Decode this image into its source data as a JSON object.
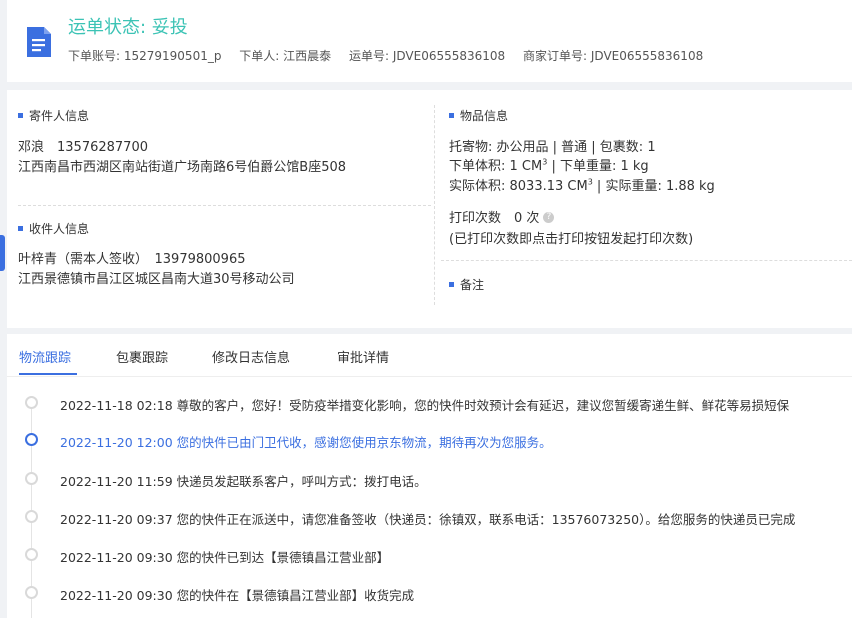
{
  "header": {
    "status_title": "运单状态: 妥投",
    "order_account": "下单账号: 15279190501_p",
    "orderer": "下单人: 江西晨泰",
    "waybill": "运单号: JDVE06555836108",
    "merchant_order": "商家订单号: JDVE06555836108",
    "icon": "document-icon"
  },
  "sender": {
    "title": "寄件人信息",
    "name_phone": "邓浪　13576287700",
    "address": "江西南昌市西湖区南站街道广场南路6号伯爵公馆B座508"
  },
  "receiver": {
    "title": "收件人信息",
    "name_phone": "叶梓青（需本人签收）　13979800965",
    "address": "江西景德镇市昌江区城区昌南大道30号移动公司"
  },
  "goods": {
    "title": "物品信息",
    "line1": "托寄物:  办公用品 | 普通 | 包裹数:  1",
    "order_volume_label": "下单体积:  1 CM",
    "order_volume_sup": "3",
    "order_weight": " | 下单重量:  1 kg",
    "actual_volume_label": "实际体积:  8033.13 CM",
    "actual_volume_sup": "3",
    "actual_weight": " | 实际重量:  1.88 kg",
    "print_count": "打印次数　0 次",
    "print_note": "(已打印次数即点击打印按钮发起打印次数)"
  },
  "remark": {
    "title": "备注"
  },
  "tabs": [
    "物流跟踪",
    "包裹跟踪",
    "修改日志信息",
    "审批详情"
  ],
  "timeline": [
    {
      "text": "2022-11-18 02:18  尊敬的客户，您好！受防疫举措变化影响，您的快件时效预计会有延迟，建议您暂缓寄递生鲜、鲜花等易损短保",
      "active": false
    },
    {
      "text": "2022-11-20 12:00  您的快件已由门卫代收，感谢您使用京东物流，期待再次为您服务。",
      "active": true
    },
    {
      "text": "2022-11-20 11:59  快递员发起联系客户，呼叫方式：拨打电话。",
      "active": false
    },
    {
      "text": "2022-11-20 09:37  您的快件正在派送中，请您准备签收（快递员：徐镇双，联系电话：13576073250）。给您服务的快递员已完成",
      "active": false
    },
    {
      "text": "2022-11-20 09:30  您的快件已到达【景德镇昌江营业部】",
      "active": false
    },
    {
      "text": "2022-11-20 09:30  您的快件在【景德镇昌江营业部】收货完成",
      "active": false
    }
  ],
  "colors": {
    "accent": "#3b6fe0",
    "status": "#3cc3b5"
  }
}
